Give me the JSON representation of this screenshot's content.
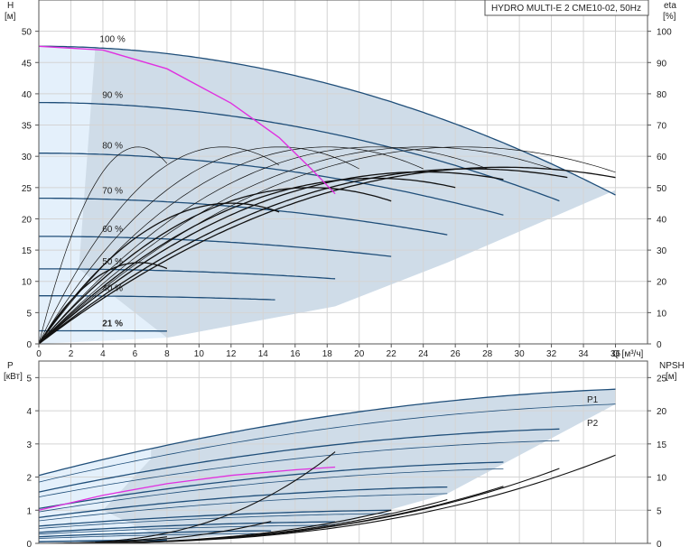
{
  "title": "HYDRO MULTI-E 2 CME10-02, 50Hz",
  "chart_data": [
    {
      "name": "head-eta",
      "type": "line",
      "x_ticks": [
        0,
        2,
        4,
        6,
        8,
        10,
        12,
        14,
        16,
        18,
        20,
        22,
        24,
        26,
        28,
        30,
        32,
        34,
        36
      ],
      "xlim": [
        0,
        38
      ],
      "xlabel": "Q [м³/ч]",
      "left_axis": {
        "label_top": "H",
        "label_unit": "[м]",
        "ticks": [
          0,
          5,
          10,
          15,
          20,
          25,
          30,
          35,
          40,
          45,
          50
        ],
        "lim": [
          0,
          55
        ]
      },
      "right_axis": {
        "label_top": "eta",
        "label_unit": "[%]",
        "ticks": [
          0,
          10,
          20,
          30,
          40,
          50,
          60,
          70,
          80,
          90,
          100
        ],
        "lim": [
          0,
          110
        ]
      },
      "head_curves": [
        {
          "name": "100 %",
          "H0": 47.6,
          "Qmax": 36
        },
        {
          "name": "90 %",
          "H0": 38.6,
          "Qmax": 32.5
        },
        {
          "name": "80 %",
          "H0": 30.5,
          "Qmax": 29
        },
        {
          "name": "70 %",
          "H0": 23.3,
          "Qmax": 25.5
        },
        {
          "name": "60 %",
          "H0": 17.2,
          "Qmax": 22
        },
        {
          "name": "50 %",
          "H0": 12.0,
          "Qmax": 18.5
        },
        {
          "name": "40 %",
          "H0": 7.7,
          "Qmax": 14.8
        },
        {
          "name": "21 %",
          "H0": 2.1,
          "Qmax": 8
        }
      ],
      "labels": [
        "100 %",
        "90 %",
        "80 %",
        "70 %",
        "60 %",
        "50 %",
        "40 %",
        "21 %"
      ],
      "eta_curves": [
        {
          "peak_q": 6.2,
          "peak_eta": 63,
          "qmax": 8
        },
        {
          "peak_q": 11.5,
          "peak_eta": 63,
          "qmax": 15
        },
        {
          "peak_q": 15,
          "peak_eta": 63,
          "qmax": 20
        },
        {
          "peak_q": 18,
          "peak_eta": 63,
          "qmax": 24
        },
        {
          "peak_q": 21,
          "peak_eta": 63,
          "qmax": 28
        },
        {
          "peak_q": 24,
          "peak_eta": 63,
          "qmax": 32
        },
        {
          "peak_q": 26.5,
          "peak_eta": 63,
          "qmax": 36
        },
        {
          "peak_q": 6.3,
          "peak_eta": 26,
          "qmax": 8
        },
        {
          "peak_q": 12,
          "peak_eta": 45,
          "qmax": 15
        },
        {
          "peak_q": 17,
          "peak_eta": 50,
          "qmax": 22
        },
        {
          "peak_q": 21,
          "peak_eta": 53,
          "qmax": 26
        },
        {
          "peak_q": 24,
          "peak_eta": 55,
          "qmax": 29
        },
        {
          "peak_q": 27,
          "peak_eta": 56,
          "qmax": 33
        },
        {
          "peak_q": 29,
          "peak_eta": 56.5,
          "qmax": 36
        }
      ],
      "highlight_curve": [
        [
          0,
          47.6
        ],
        [
          4,
          47
        ],
        [
          8,
          44
        ],
        [
          12,
          38.5
        ],
        [
          15,
          33
        ],
        [
          17,
          28
        ],
        [
          18.5,
          24
        ]
      ]
    },
    {
      "name": "power-npsh",
      "type": "line",
      "x_ticks": [
        0,
        2,
        4,
        6,
        8,
        10,
        12,
        14,
        16,
        18,
        20,
        22,
        24,
        26,
        28,
        30,
        32,
        34,
        36
      ],
      "xlim": [
        0,
        38
      ],
      "left_axis": {
        "label_top": "P",
        "label_unit": "[кВт]",
        "ticks": [
          0,
          1,
          2,
          3,
          4,
          5
        ],
        "lim": [
          0,
          5.5
        ]
      },
      "right_axis": {
        "label_top": "NPSH",
        "label_unit": "[м]",
        "ticks": [
          0,
          5,
          10,
          15,
          20,
          25
        ],
        "lim": [
          0,
          27.5
        ]
      },
      "series_labels": [
        "P1",
        "P2"
      ],
      "power_curves": [
        {
          "p0": 2.05,
          "pmax": 4.65,
          "qmax": 36
        },
        {
          "p0": 1.85,
          "pmax": 4.2,
          "qmax": 36
        },
        {
          "p0": 1.55,
          "pmax": 3.45,
          "qmax": 32.5
        },
        {
          "p0": 1.4,
          "pmax": 3.1,
          "qmax": 32.5
        },
        {
          "p0": 1.05,
          "pmax": 2.45,
          "qmax": 29
        },
        {
          "p0": 0.95,
          "pmax": 2.25,
          "qmax": 29
        },
        {
          "p0": 0.78,
          "pmax": 1.7,
          "qmax": 25.5
        },
        {
          "p0": 0.68,
          "pmax": 1.5,
          "qmax": 25.5
        },
        {
          "p0": 0.52,
          "pmax": 1.0,
          "qmax": 22
        },
        {
          "p0": 0.45,
          "pmax": 0.9,
          "qmax": 22
        },
        {
          "p0": 0.33,
          "pmax": 0.65,
          "qmax": 18.5
        },
        {
          "p0": 0.28,
          "pmax": 0.55,
          "qmax": 18.5
        },
        {
          "p0": 0.2,
          "pmax": 0.38,
          "qmax": 14.8
        },
        {
          "p0": 0.15,
          "pmax": 0.3,
          "qmax": 14.8
        },
        {
          "p0": 0.05,
          "pmax": 0.1,
          "qmax": 8
        },
        {
          "p0": 0.04,
          "pmax": 0.08,
          "qmax": 8
        }
      ],
      "highlight_power": [
        [
          0,
          1.0
        ],
        [
          4,
          1.45
        ],
        [
          8,
          1.8
        ],
        [
          12,
          2.05
        ],
        [
          16,
          2.22
        ],
        [
          18.5,
          2.3
        ]
      ],
      "npsh_curves": [
        {
          "qmax": 36,
          "npsh_max": 13.3
        },
        {
          "qmax": 32.5,
          "npsh_max": 11.3
        },
        {
          "qmax": 29,
          "npsh_max": 8.6
        },
        {
          "qmax": 25.5,
          "npsh_max": 6.6
        },
        {
          "qmax": 22,
          "npsh_max": 5.0
        },
        {
          "qmax": 18.5,
          "npsh_max": 13.8
        },
        {
          "qmax": 14.8,
          "npsh_max": 3.5
        },
        {
          "qmax": 8,
          "npsh_max": 1.0
        }
      ]
    }
  ],
  "colors": {
    "head_curve": "#1f4e79",
    "eta_curve": "#111111",
    "highlight": "#e030e0",
    "fill": "#cfdce8",
    "fill_light": "#e4f0fb"
  }
}
